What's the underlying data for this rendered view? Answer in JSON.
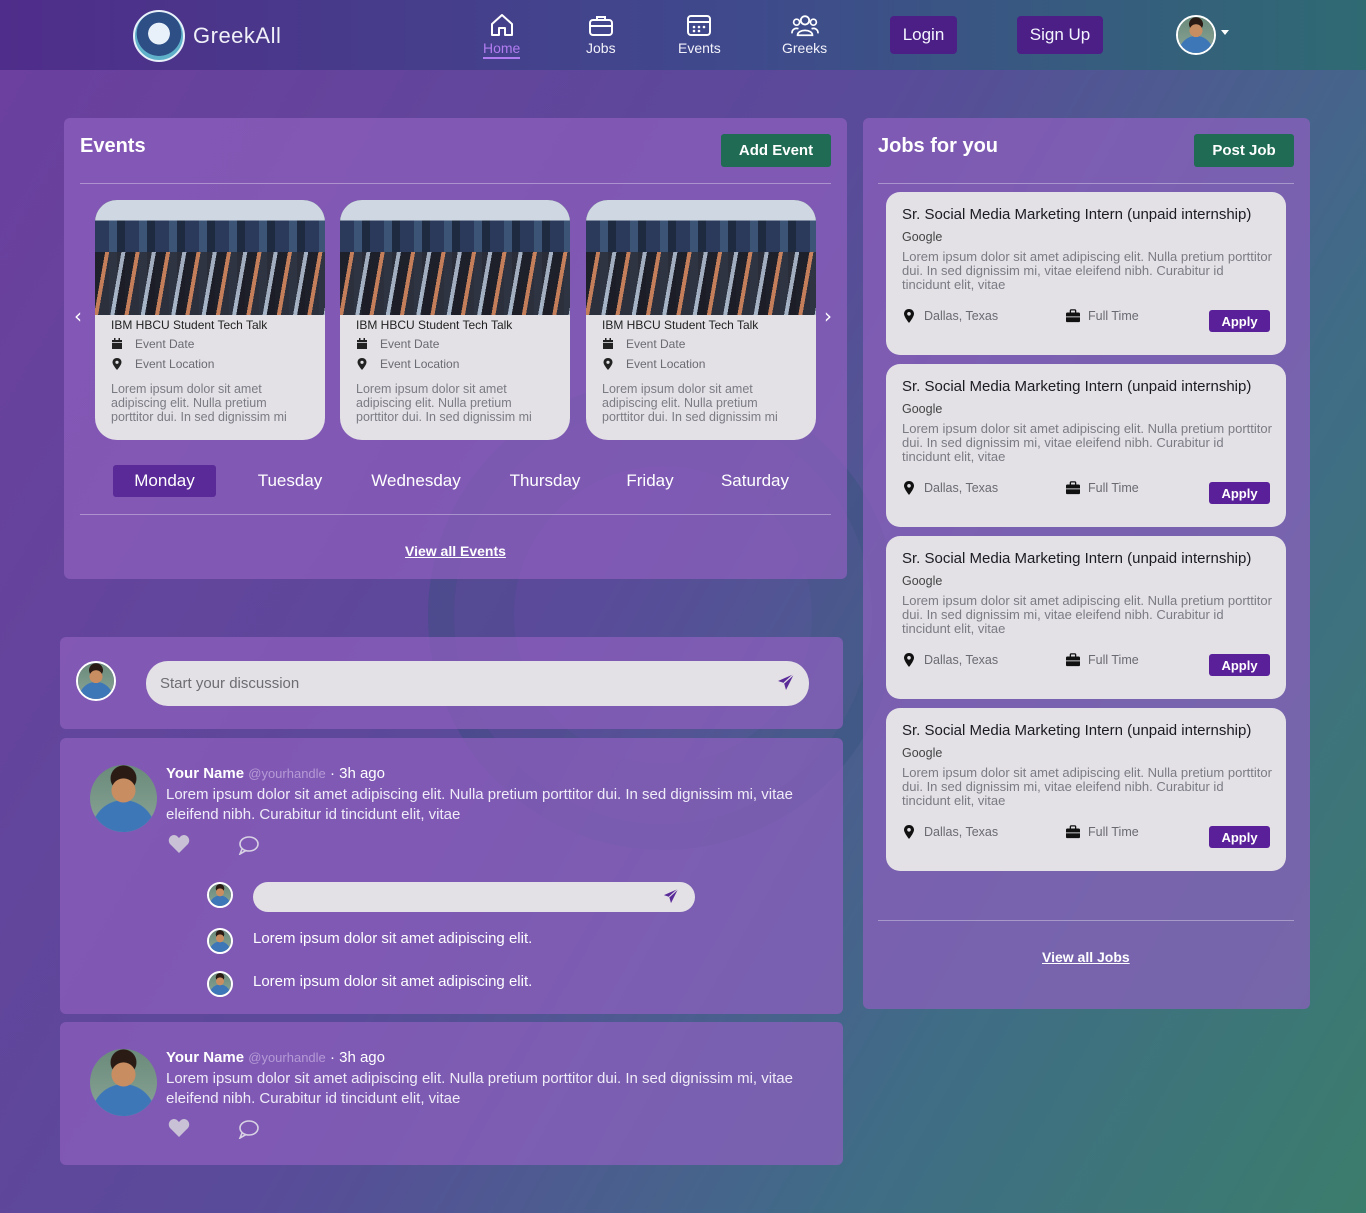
{
  "brand": {
    "name": "GreekAll"
  },
  "nav": {
    "items": [
      {
        "label": "Home",
        "icon": "home-icon",
        "active": true
      },
      {
        "label": "Jobs",
        "icon": "briefcase-icon"
      },
      {
        "label": "Events",
        "icon": "calendar-icon"
      },
      {
        "label": "Greeks",
        "icon": "users-icon"
      }
    ],
    "login": "Login",
    "signup": "Sign Up"
  },
  "events": {
    "title": "Events",
    "add_label": "Add Event",
    "cards": [
      {
        "title": "IBM HBCU Student Tech Talk",
        "date": "Event Date",
        "location": "Event Location",
        "desc": "Lorem ipsum dolor sit amet adipiscing elit. Nulla pretium porttitor dui. In sed dignissim mi"
      },
      {
        "title": "IBM HBCU Student Tech Talk",
        "date": "Event Date",
        "location": "Event Location",
        "desc": "Lorem ipsum dolor sit amet adipiscing elit. Nulla pretium porttitor dui. In sed dignissim mi"
      },
      {
        "title": "IBM HBCU Student Tech Talk",
        "date": "Event Date",
        "location": "Event Location",
        "desc": "Lorem ipsum dolor sit amet adipiscing elit. Nulla pretium porttitor dui. In sed dignissim mi"
      }
    ],
    "days": [
      "Monday",
      "Tuesday",
      "Wednesday",
      "Thursday",
      "Friday",
      "Saturday"
    ],
    "active_day": "Monday",
    "view_all": "View all Events"
  },
  "discussion": {
    "placeholder": "Start your discussion"
  },
  "posts": [
    {
      "name": "Your Name",
      "handle": "@yourhandle",
      "time": "· 3h ago",
      "body": "Lorem ipsum dolor sit amet adipiscing elit. Nulla pretium porttitor dui. In sed dignissim mi, vitae eleifend nibh. Curabitur id tincidunt elit, vitae",
      "comments": [
        "Lorem ipsum dolor sit amet adipiscing elit.",
        "Lorem ipsum dolor sit amet adipiscing elit."
      ]
    },
    {
      "name": "Your Name",
      "handle": "@yourhandle",
      "time": "· 3h ago",
      "body": "Lorem ipsum dolor sit amet adipiscing elit. Nulla pretium porttitor dui. In sed dignissim mi, vitae eleifend nibh. Curabitur id tincidunt elit, vitae"
    }
  ],
  "jobs": {
    "title": "Jobs for you",
    "post_label": "Post Job",
    "view_all": "View all Jobs",
    "cards": [
      {
        "title": "Sr. Social Media Marketing Intern (unpaid internship)",
        "company": "Google",
        "desc": "Lorem ipsum dolor sit amet adipiscing elit. Nulla pretium porttitor dui. In sed dignissim mi, vitae eleifend nibh. Curabitur id tincidunt elit, vitae",
        "location": "Dallas, Texas",
        "type": "Full Time",
        "apply": "Apply"
      },
      {
        "title": "Sr. Social Media Marketing Intern (unpaid internship)",
        "company": "Google",
        "desc": "Lorem ipsum dolor sit amet adipiscing elit. Nulla pretium porttitor dui. In sed dignissim mi, vitae eleifend nibh. Curabitur id tincidunt elit, vitae",
        "location": "Dallas, Texas",
        "type": "Full Time",
        "apply": "Apply"
      },
      {
        "title": "Sr. Social Media Marketing Intern (unpaid internship)",
        "company": "Google",
        "desc": "Lorem ipsum dolor sit amet adipiscing elit. Nulla pretium porttitor dui. In sed dignissim mi, vitae eleifend nibh. Curabitur id tincidunt elit, vitae",
        "location": "Dallas, Texas",
        "type": "Full Time",
        "apply": "Apply"
      },
      {
        "title": "Sr. Social Media Marketing Intern (unpaid internship)",
        "company": "Google",
        "desc": "Lorem ipsum dolor sit amet adipiscing elit. Nulla pretium porttitor dui. In sed dignissim mi, vitae eleifend nibh. Curabitur id tincidunt elit, vitae",
        "location": "Dallas, Texas",
        "type": "Full Time",
        "apply": "Apply"
      }
    ]
  },
  "colors": {
    "accent": "#5a2a99",
    "green": "#1f6b54",
    "card": "#e3e1e6"
  }
}
